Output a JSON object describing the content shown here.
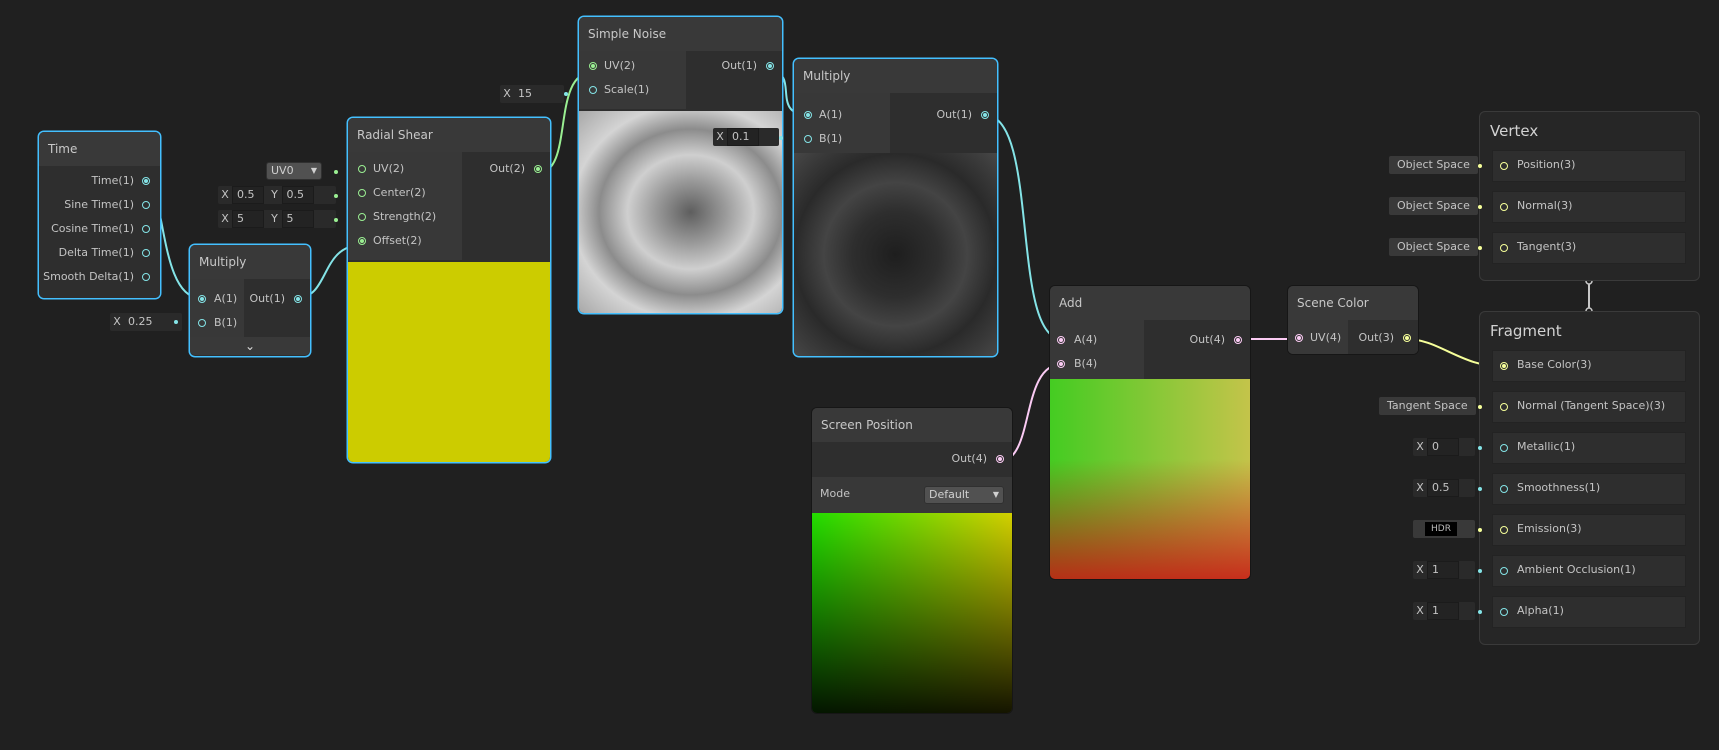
{
  "nodes": {
    "time": {
      "title": "Time",
      "outputs": [
        "Time(1)",
        "Sine Time(1)",
        "Cosine Time(1)",
        "Delta Time(1)",
        "Smooth Delta(1)"
      ]
    },
    "multiply_a": {
      "title": "Multiply",
      "inputs": [
        "A(1)",
        "B(1)"
      ],
      "output": "Out(1)",
      "b_field": {
        "label": "X",
        "value": "0.25"
      }
    },
    "radial_shear": {
      "title": "Radial Shear",
      "inputs": [
        "UV(2)",
        "Center(2)",
        "Strength(2)",
        "Offset(2)"
      ],
      "output": "Out(2)",
      "uv_dropdown": "UV0",
      "center_field": {
        "x_label": "X",
        "x": "0.5",
        "y_label": "Y",
        "y": "0.5"
      },
      "strength_field": {
        "x_label": "X",
        "x": "5",
        "y_label": "Y",
        "y": "5"
      },
      "preview_color": "#cccc00"
    },
    "simple_noise": {
      "title": "Simple Noise",
      "inputs": [
        "UV(2)",
        "Scale(1)"
      ],
      "output": "Out(1)",
      "scale_field": {
        "label": "X",
        "value": "15"
      }
    },
    "multiply_b": {
      "title": "Multiply",
      "inputs": [
        "A(1)",
        "B(1)"
      ],
      "output": "Out(1)",
      "b_field": {
        "label": "X",
        "value": "0.1"
      }
    },
    "screen_position": {
      "title": "Screen Position",
      "output": "Out(4)",
      "mode_label": "Mode",
      "mode_value": "Default"
    },
    "add": {
      "title": "Add",
      "inputs": [
        "A(4)",
        "B(4)"
      ],
      "output": "Out(4)"
    },
    "scene_color": {
      "title": "Scene Color",
      "input": "UV(4)",
      "output": "Out(3)"
    }
  },
  "master": {
    "vertex": {
      "title": "Vertex",
      "blocks": [
        {
          "label": "Position(3)",
          "tag": "Object Space"
        },
        {
          "label": "Normal(3)",
          "tag": "Object Space"
        },
        {
          "label": "Tangent(3)",
          "tag": "Object Space"
        }
      ]
    },
    "fragment": {
      "title": "Fragment",
      "blocks": [
        {
          "label": "Base Color(3)",
          "tag": ""
        },
        {
          "label": "Normal (Tangent Space)(3)",
          "tag": "Tangent Space"
        },
        {
          "label": "Metallic(1)",
          "x_label": "X",
          "value": "0"
        },
        {
          "label": "Smoothness(1)",
          "x_label": "X",
          "value": "0.5"
        },
        {
          "label": "Emission(3)",
          "value": "HDR"
        },
        {
          "label": "Ambient Occlusion(1)",
          "x_label": "X",
          "value": "1"
        },
        {
          "label": "Alpha(1)",
          "x_label": "X",
          "value": "1"
        }
      ]
    }
  },
  "colors": {
    "background": "#202020",
    "selection": "#44c0ff",
    "float_port": "#84e4e7",
    "vec2_port": "#9aef92",
    "vec3_port": "#f6ff9a",
    "vec4_port": "#fbcbf4"
  }
}
